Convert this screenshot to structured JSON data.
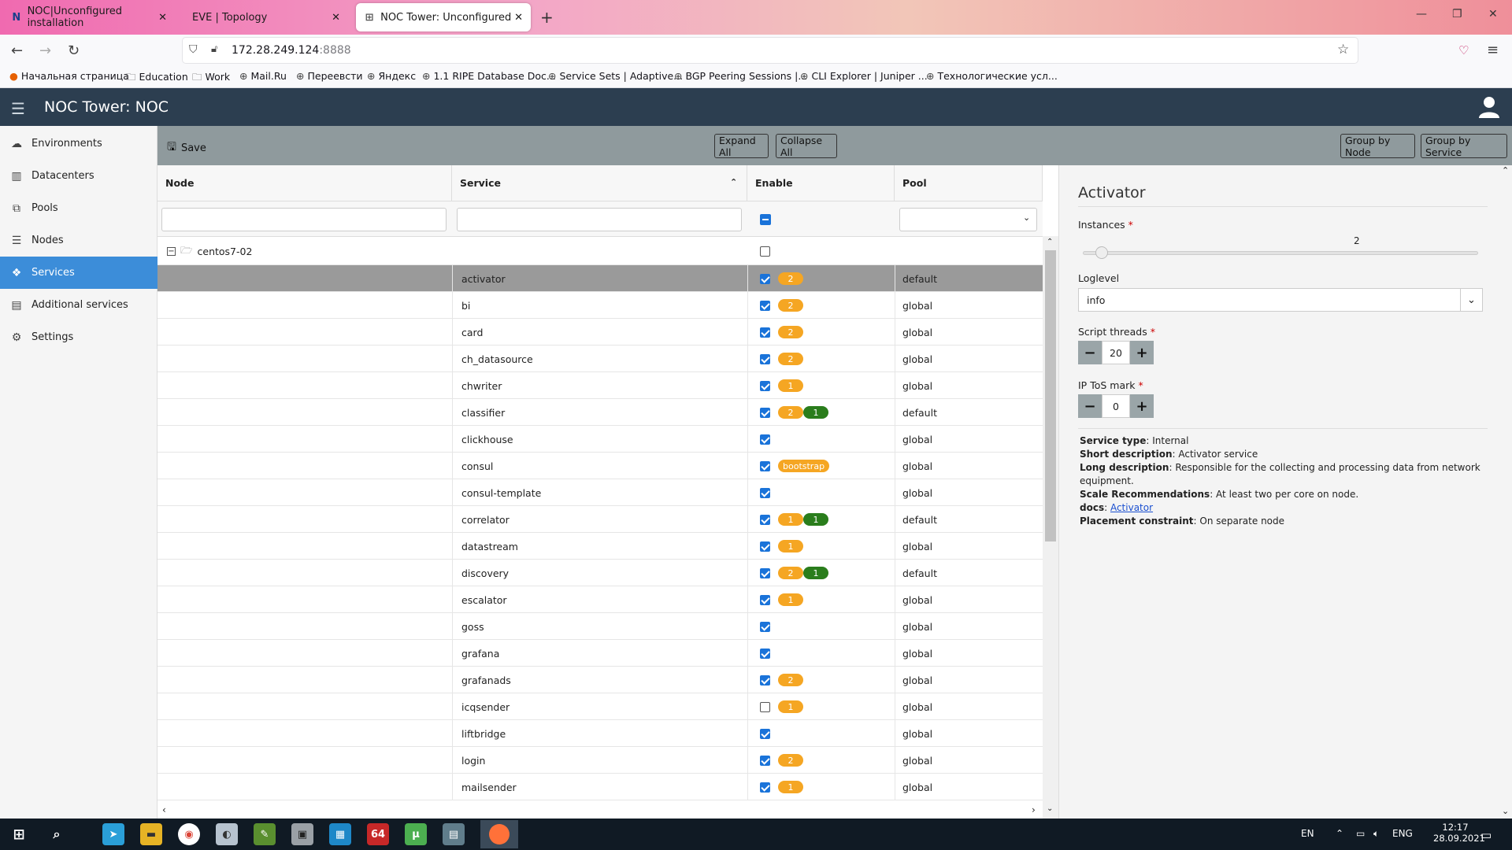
{
  "browser": {
    "tabs": [
      {
        "title": "NOC|Unconfigured installation",
        "favicon": "noc-icon"
      },
      {
        "title": "EVE | Topology",
        "favicon": "eve-icon"
      },
      {
        "title": "NOC Tower: Unconfigured insta",
        "favicon": "noc-tower-icon"
      }
    ],
    "url_host": "172.28.249.124",
    "url_port": ":8888",
    "bookmarks": [
      "Начальная страница",
      "Education",
      "Work",
      "Mail.Ru",
      "Переевсти",
      "Яндекс",
      "1.1 RIPE Database Doc...",
      "Service Sets | Adaptive...",
      "BGP Peering Sessions |...",
      "CLI Explorer | Juniper ...",
      "Технологические усл..."
    ]
  },
  "app": {
    "title": "NOC Tower: NOC"
  },
  "sidebar": {
    "items": [
      {
        "label": "Environments",
        "icon": "cloud-icon"
      },
      {
        "label": "Datacenters",
        "icon": "building-icon"
      },
      {
        "label": "Pools",
        "icon": "copy-icon"
      },
      {
        "label": "Nodes",
        "icon": "server-icon"
      },
      {
        "label": "Services",
        "icon": "cubes-icon"
      },
      {
        "label": "Additional services",
        "icon": "archive-icon"
      },
      {
        "label": "Settings",
        "icon": "gear-icon"
      }
    ],
    "active": "Services"
  },
  "toolbar": {
    "save_label": "Save",
    "expand_all": "Expand All",
    "collapse_all": "Collapse All",
    "group_by_node": "Group by Node",
    "group_by_service": "Group by Service"
  },
  "grid": {
    "columns": [
      "Node",
      "Service",
      "Enable",
      "Pool"
    ],
    "group_node": "centos7-02",
    "rows": [
      {
        "service": "activator",
        "enabled": true,
        "badges": [
          {
            "text": "2",
            "color": "orange"
          }
        ],
        "pool": "default",
        "selected": true
      },
      {
        "service": "bi",
        "enabled": true,
        "badges": [
          {
            "text": "2",
            "color": "orange"
          }
        ],
        "pool": "global"
      },
      {
        "service": "card",
        "enabled": true,
        "badges": [
          {
            "text": "2",
            "color": "orange"
          }
        ],
        "pool": "global"
      },
      {
        "service": "ch_datasource",
        "enabled": true,
        "badges": [
          {
            "text": "2",
            "color": "orange"
          }
        ],
        "pool": "global"
      },
      {
        "service": "chwriter",
        "enabled": true,
        "badges": [
          {
            "text": "1",
            "color": "orange"
          }
        ],
        "pool": "global"
      },
      {
        "service": "classifier",
        "enabled": true,
        "badges": [
          {
            "text": "2",
            "color": "orange"
          },
          {
            "text": "1",
            "color": "green"
          }
        ],
        "pool": "default"
      },
      {
        "service": "clickhouse",
        "enabled": true,
        "badges": [],
        "pool": "global"
      },
      {
        "service": "consul",
        "enabled": true,
        "badges": [
          {
            "text": "bootstrap",
            "color": "orange"
          }
        ],
        "pool": "global"
      },
      {
        "service": "consul-template",
        "enabled": true,
        "badges": [],
        "pool": "global"
      },
      {
        "service": "correlator",
        "enabled": true,
        "badges": [
          {
            "text": "1",
            "color": "orange"
          },
          {
            "text": "1",
            "color": "green"
          }
        ],
        "pool": "default"
      },
      {
        "service": "datastream",
        "enabled": true,
        "badges": [
          {
            "text": "1",
            "color": "orange"
          }
        ],
        "pool": "global"
      },
      {
        "service": "discovery",
        "enabled": true,
        "badges": [
          {
            "text": "2",
            "color": "orange"
          },
          {
            "text": "1",
            "color": "green"
          }
        ],
        "pool": "default"
      },
      {
        "service": "escalator",
        "enabled": true,
        "badges": [
          {
            "text": "1",
            "color": "orange"
          }
        ],
        "pool": "global"
      },
      {
        "service": "goss",
        "enabled": true,
        "badges": [],
        "pool": "global"
      },
      {
        "service": "grafana",
        "enabled": true,
        "badges": [],
        "pool": "global"
      },
      {
        "service": "grafanads",
        "enabled": true,
        "badges": [
          {
            "text": "2",
            "color": "orange"
          }
        ],
        "pool": "global"
      },
      {
        "service": "icqsender",
        "enabled": false,
        "badges": [
          {
            "text": "1",
            "color": "orange"
          }
        ],
        "pool": "global"
      },
      {
        "service": "liftbridge",
        "enabled": true,
        "badges": [],
        "pool": "global"
      },
      {
        "service": "login",
        "enabled": true,
        "badges": [
          {
            "text": "2",
            "color": "orange"
          }
        ],
        "pool": "global"
      },
      {
        "service": "mailsender",
        "enabled": true,
        "badges": [
          {
            "text": "1",
            "color": "orange"
          }
        ],
        "pool": "global"
      }
    ]
  },
  "panel": {
    "title": "Activator",
    "instances_label": "Instances",
    "instances_value": "2",
    "instances_level": 0.03,
    "loglevel_label": "Loglevel",
    "loglevel_value": "info",
    "script_threads_label": "Script threads",
    "script_threads_value": "20",
    "ip_tos_label": "IP ToS mark",
    "ip_tos_value": "0",
    "required_mark": "*",
    "info": {
      "service_type_key": "Service type",
      "service_type": "Internal",
      "short_desc_key": "Short description",
      "short_desc": "Activator service",
      "long_desc_key": "Long description",
      "long_desc": "Responsible for the collecting and processing data from network equipment.",
      "scale_key": "Scale Recommendations",
      "scale": "At least two per core on node.",
      "docs_key": "docs",
      "docs_link": "Activator",
      "placement_key": "Placement constraint",
      "placement": "On separate node"
    }
  },
  "taskbar": {
    "lang1": "EN",
    "lang2": "ENG",
    "time": "12:17",
    "date": "28.09.2021",
    "app_badge_64": "64"
  },
  "colors": {
    "header": "#2c3e50",
    "active_nav": "#3c8dd9",
    "toolbar": "#8f9a9d",
    "badge_orange": "#f5a623",
    "badge_green": "#2a7d1c"
  }
}
